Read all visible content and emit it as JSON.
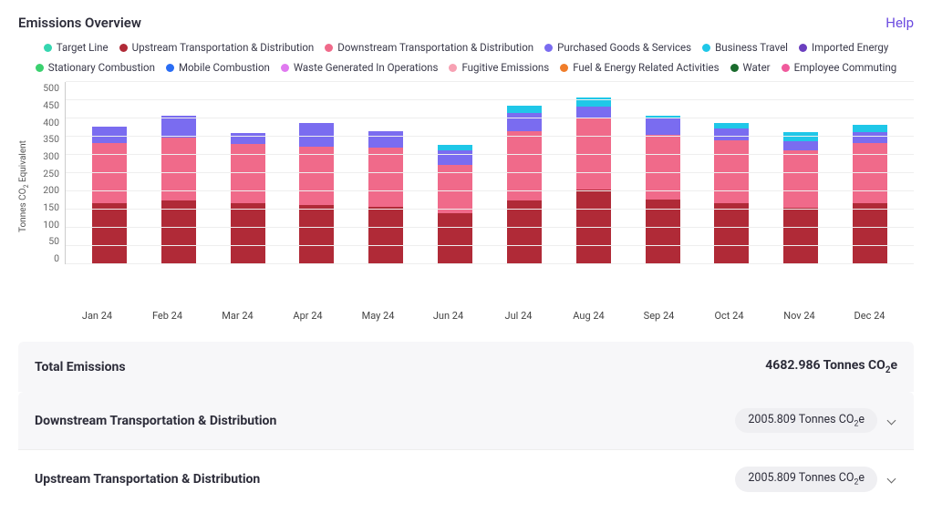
{
  "header": {
    "title": "Emissions Overview",
    "help": "Help"
  },
  "legend": [
    {
      "name": "Target Line",
      "color": "#35d6b0"
    },
    {
      "name": "Upstream Transportation & Distribution",
      "color": "#b02a37"
    },
    {
      "name": "Downstream Transportation & Distribution",
      "color": "#f06a8a"
    },
    {
      "name": "Purchased Goods & Services",
      "color": "#7a6cf0"
    },
    {
      "name": "Business Travel",
      "color": "#1fc7e8"
    },
    {
      "name": "Imported Energy",
      "color": "#6b3fbf"
    },
    {
      "name": "Stationary Combustion",
      "color": "#3bd16f"
    },
    {
      "name": "Mobile Combustion",
      "color": "#2a6df4"
    },
    {
      "name": "Waste Generated In Operations",
      "color": "#e07af0"
    },
    {
      "name": "Fugitive Emissions",
      "color": "#f7a1b3"
    },
    {
      "name": "Fuel & Energy Related Activities",
      "color": "#f07d2a"
    },
    {
      "name": "Water",
      "color": "#1a6b2d"
    },
    {
      "name": "Employee Commuting",
      "color": "#f05a9c"
    }
  ],
  "chart_data": {
    "type": "bar",
    "title": "Emissions Overview",
    "xlabel": "",
    "ylabel": "Tonnes CO₂ Equivalent",
    "ylim": [
      0,
      500
    ],
    "yticks": [
      0,
      50,
      100,
      150,
      200,
      250,
      300,
      350,
      400,
      450,
      500
    ],
    "categories": [
      "Jan 24",
      "Feb 24",
      "Mar 24",
      "Apr 24",
      "May 24",
      "Jun 24",
      "Jul 24",
      "Aug 24",
      "Sep 24",
      "Oct 24",
      "Nov 24",
      "Dec 24"
    ],
    "series": [
      {
        "name": "Upstream Transportation & Distribution",
        "color": "#b02a37",
        "values": [
          168,
          175,
          168,
          162,
          158,
          140,
          175,
          205,
          178,
          168,
          155,
          168
        ]
      },
      {
        "name": "Downstream Transportation & Distribution",
        "color": "#f06a8a",
        "values": [
          165,
          172,
          162,
          160,
          162,
          132,
          190,
          198,
          178,
          172,
          158,
          165
        ]
      },
      {
        "name": "Purchased Goods & Services",
        "color": "#7a6cf0",
        "values": [
          45,
          60,
          30,
          65,
          45,
          40,
          50,
          30,
          45,
          32,
          25,
          30
        ]
      },
      {
        "name": "Business Travel",
        "color": "#1fc7e8",
        "values": [
          0,
          0,
          0,
          0,
          0,
          15,
          20,
          25,
          8,
          15,
          25,
          20
        ]
      }
    ]
  },
  "summary": {
    "total_label": "Total Emissions",
    "total_value": "4682.986 Tonnes CO₂e",
    "rows": [
      {
        "label": "Downstream Transportation & Distribution",
        "value": "2005.809 Tonnes CO₂e"
      },
      {
        "label": "Upstream Transportation & Distribution",
        "value": "2005.809 Tonnes CO₂e"
      }
    ]
  }
}
